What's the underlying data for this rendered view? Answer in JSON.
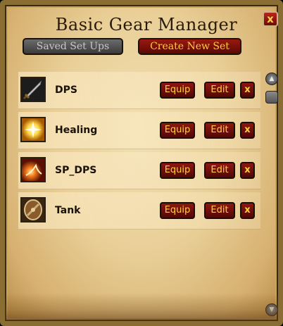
{
  "window": {
    "title": "Basic Gear Manager",
    "close_label": "x"
  },
  "tabs": {
    "saved_label": "Saved Set Ups",
    "create_label": "Create New Set"
  },
  "sets": [
    {
      "name": "DPS",
      "icon": "sword-icon"
    },
    {
      "name": "Healing",
      "icon": "holy-light-icon"
    },
    {
      "name": "SP_DPS",
      "icon": "fire-spell-icon"
    },
    {
      "name": "Tank",
      "icon": "shield-icon"
    }
  ],
  "buttons": {
    "equip_label": "Equip",
    "edit_label": "Edit",
    "delete_label": "x"
  },
  "colors": {
    "button_red": "#8e1610",
    "button_text": "#ffd23a",
    "parchment": "#e9cf97"
  }
}
